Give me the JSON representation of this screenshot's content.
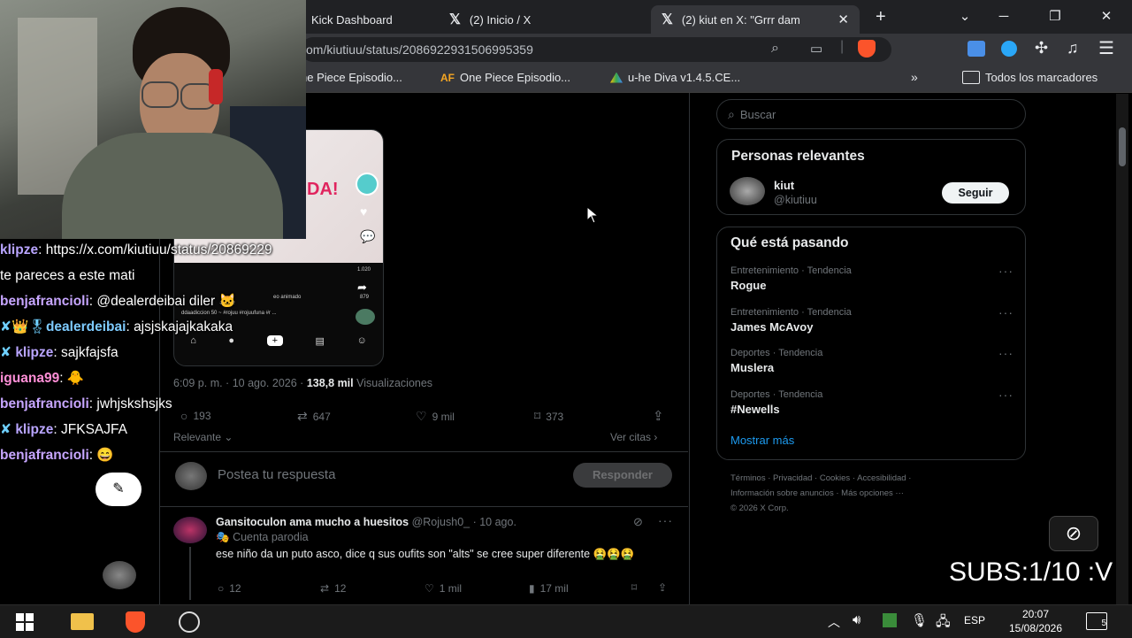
{
  "browser": {
    "tabs": [
      {
        "title": "Kick Dashboard",
        "active": false
      },
      {
        "title": "(2) Inicio / X",
        "active": false
      },
      {
        "title": "(2) kiut en X: \"Grrr dam",
        "active": true
      }
    ],
    "url": "x.com/kiutiuu/status/2086922931506995359",
    "url_visible": "om/kiutiuu/status/2086922931506995359",
    "bookmarks": [
      "ne Piece Episodio...",
      "One Piece Episodio...",
      "u-he Diva v1.4.5.CE...",
      "Todos los marcadores"
    ],
    "bookmark_prefix": "AF",
    "window_controls": {
      "minimize": "─",
      "maximize": "❐",
      "close": "✕"
    }
  },
  "tweet": {
    "timestamp": "6:09 p. m. · 10 ago. 2026 ·",
    "views_count": "138,8 mil",
    "views_label": "Visualizaciones",
    "replies": "193",
    "reposts": "647",
    "likes": "9 mil",
    "bookmarks": "373",
    "sort_label": "Relevante",
    "quotes_label": "Ver citas",
    "reply_placeholder": "Postea tu respuesta",
    "reply_button": "Responder",
    "media_text": "DA!",
    "media_counts": [
      "1.020",
      "879"
    ],
    "media_caption": "ddaadiccion 50 ~ #rojuu #rojuufuna #r ...",
    "media_caption2": "eo animado"
  },
  "reply": {
    "display_name": "Gansitoculon ama mucho a huesitos",
    "handle": "@Rojush0_ · 10 ago.",
    "badge": "Cuenta parodia",
    "text": "ese niño da un puto asco, dice q sus oufits son \"alts\" se cree super diferente 🤮🤮🤮",
    "replies": "12",
    "reposts": "12",
    "likes": "1 mil",
    "views": "17 mil"
  },
  "sidebar": {
    "search_placeholder": "Buscar",
    "relevant_title": "Personas relevantes",
    "person_name": "kiut",
    "person_handle": "@kiutiuu",
    "follow_label": "Seguir",
    "trending_title": "Qué está pasando",
    "trends": [
      {
        "category": "Entretenimiento · Tendencia",
        "name": "Rogue"
      },
      {
        "category": "Entretenimiento · Tendencia",
        "name": "James McAvoy"
      },
      {
        "category": "Deportes · Tendencia",
        "name": "Muslera"
      },
      {
        "category": "Deportes · Tendencia",
        "name": "#Newells"
      }
    ],
    "show_more": "Mostrar más",
    "footer_line1": [
      "Términos",
      "Privacidad",
      "Cookies",
      "Accesibilidad"
    ],
    "footer_line2": [
      "Información sobre anuncios",
      "Más opciones ···"
    ],
    "footer_line3": "© 2026 X Corp."
  },
  "chat": [
    {
      "user": "klipze",
      "text": "https://x.com/kiutiuu/status/20869229",
      "badge": ""
    },
    {
      "user": "",
      "text": "te pareces a este mati",
      "badge": ""
    },
    {
      "user": "benjafrancioli",
      "text": "@dealerdeibai diler",
      "badge": ""
    },
    {
      "user": "dealerdeibai",
      "text": "ajsjskajajkakaka",
      "badge": "✘👑🎖"
    },
    {
      "user": "klipze",
      "text": "sajkfajsfa",
      "badge": "✘"
    },
    {
      "user": "iguana99",
      "text": "",
      "badge": ""
    },
    {
      "user": "benjafrancioli",
      "text": "jwhjskshsjks",
      "badge": ""
    },
    {
      "user": "klipze",
      "text": "JFKSAJFA",
      "badge": "✘"
    },
    {
      "user": "benjafrancioli",
      "text": "",
      "badge": ""
    }
  ],
  "overlay": {
    "subs_text": "SUBS:1/10 :V"
  },
  "taskbar": {
    "language": "ESP",
    "time": "20:07",
    "date": "15/08/2026",
    "notifications": "5"
  }
}
